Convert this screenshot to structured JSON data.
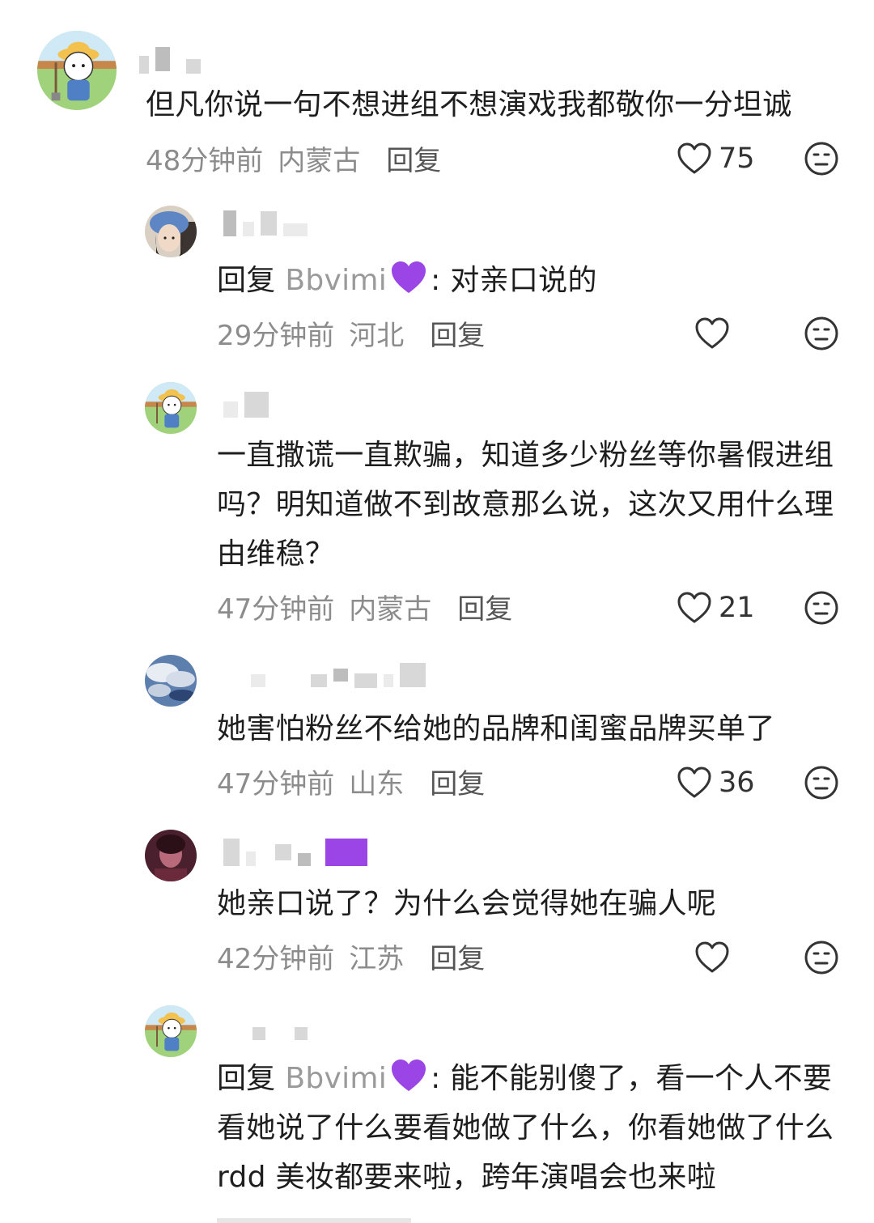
{
  "comments": [
    {
      "text": "但凡你说一句不想进组不想演戏我都敬你一分坦诚",
      "time": "48分钟前",
      "location": "内蒙古",
      "reply_label": "回复",
      "likes": "75"
    },
    {
      "mention": "Bbvimi",
      "reply_prefix": "回复",
      "text": ": 对亲口说的",
      "time": "29分钟前",
      "location": "河北",
      "reply_label": "回复",
      "likes": ""
    },
    {
      "text": "一直撒谎一直欺骗，知道多少粉丝等你暑假进组吗？明知道做不到故意那么说，这次又用什么理由维稳？",
      "time": "47分钟前",
      "location": "内蒙古",
      "reply_label": "回复",
      "likes": "21"
    },
    {
      "text": "她害怕粉丝不给她的品牌和闺蜜品牌买单了",
      "time": "47分钟前",
      "location": "山东",
      "reply_label": "回复",
      "likes": "36"
    },
    {
      "text": "她亲口说了？为什么会觉得她在骗人呢",
      "time": "42分钟前",
      "location": "江苏",
      "reply_label": "回复",
      "likes": ""
    },
    {
      "mention": "Bbvimi",
      "reply_prefix": "回复",
      "text": ": 能不能别傻了，看一个人不要看她说了什么要看她做了什么，你看她做了什么 rdd 美妆都要来啦，跨年演唱会也来啦"
    }
  ],
  "colors": {
    "meta": "#8c8c8c",
    "text": "#1e1e1e",
    "mention_heart": "#9b45e6"
  },
  "icons": {
    "like": "heart-outline-icon",
    "dislike": "neutral-face-icon",
    "mention_badge": "purple-heart-emoji"
  }
}
